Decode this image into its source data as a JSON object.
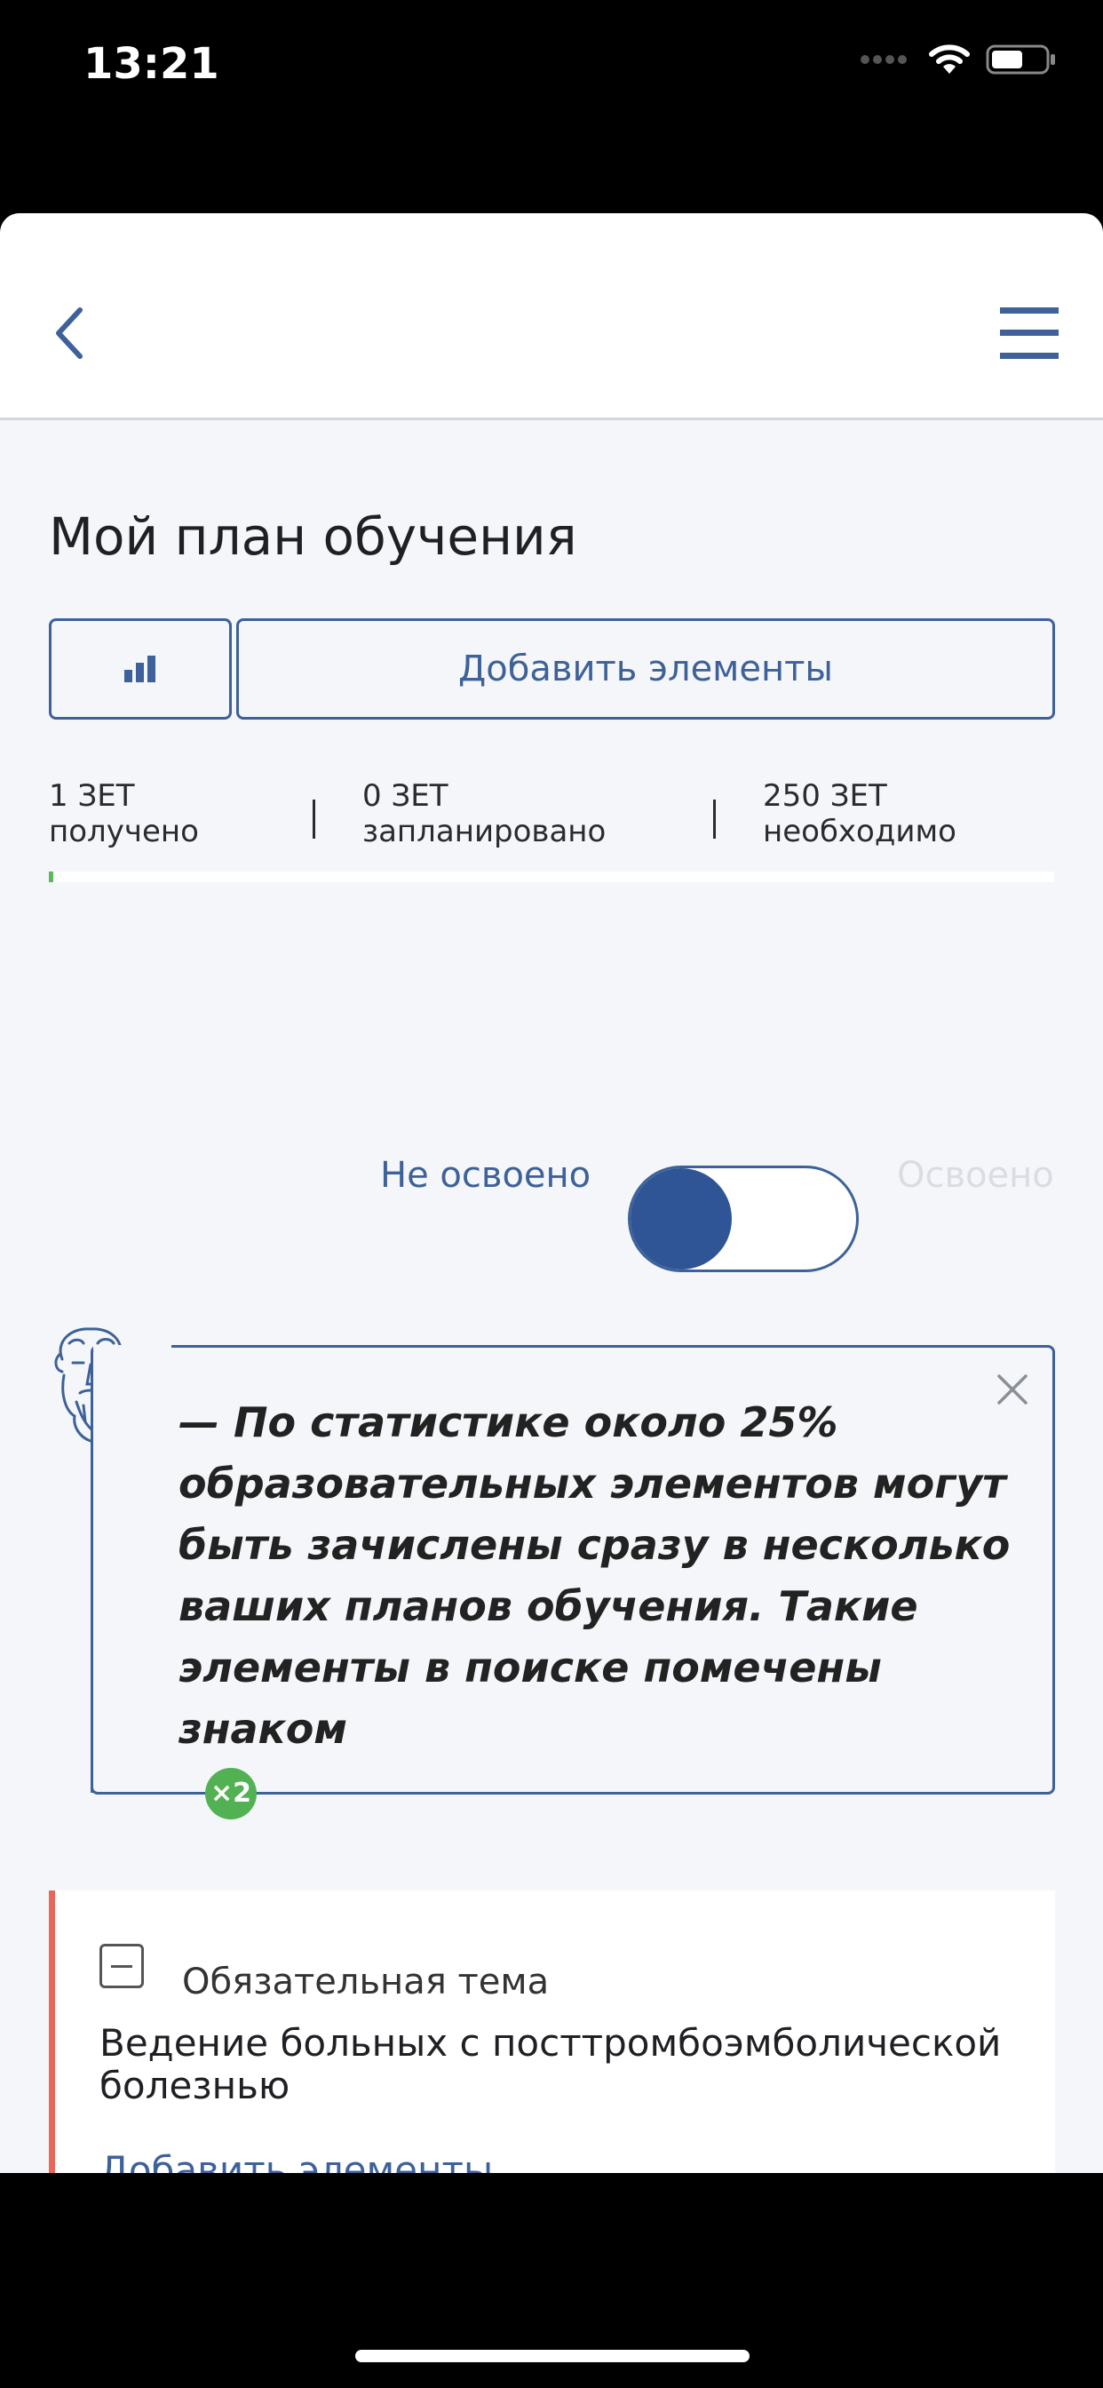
{
  "status_bar": {
    "time": "13:21"
  },
  "page": {
    "title": "Мой план обучения"
  },
  "actions": {
    "add_elements_label": "Добавить элементы"
  },
  "stats": [
    {
      "value": "1 ЗЕТ",
      "caption": "получено"
    },
    {
      "value": "0 ЗЕТ",
      "caption": "запланировано"
    },
    {
      "value": "250 ЗЕТ",
      "caption": "необходимо"
    }
  ],
  "progress": {
    "fraction": 0.004
  },
  "toggle": {
    "off_label": "Не освоено",
    "on_label": "Освоено",
    "state": "off"
  },
  "tip": {
    "text": "— По статистике около 25% образовательных элементов могут быть зачислены сразу в несколько ваших планов обучения. Такие элементы в поиске помечены знаком",
    "badge": "×2"
  },
  "topic": {
    "type": "Обязательная тема",
    "title": "Ведение больных с посттромбоэмболической болезнью",
    "add_label": "Добавить элементы"
  },
  "colors": {
    "accent": "#3d6198",
    "progress": "#5cb85c",
    "required_topic": "#e8675a",
    "badge": "#52b152"
  }
}
